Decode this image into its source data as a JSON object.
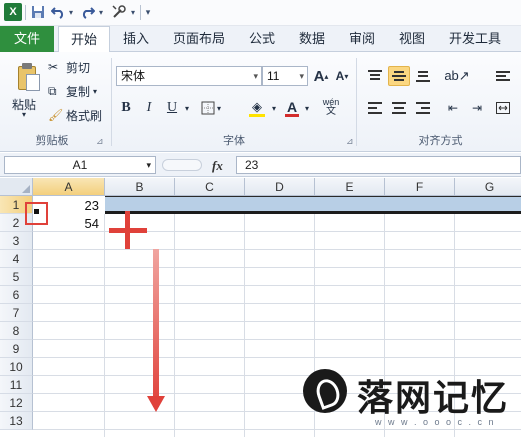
{
  "qat": {
    "app_icon": "X",
    "icons": [
      "save-icon",
      "undo-icon",
      "redo-icon",
      "customize-icon"
    ]
  },
  "tabs": [
    {
      "label": "文件"
    },
    {
      "label": "开始"
    },
    {
      "label": "插入"
    },
    {
      "label": "页面布局"
    },
    {
      "label": "公式"
    },
    {
      "label": "数据"
    },
    {
      "label": "审阅"
    },
    {
      "label": "视图"
    },
    {
      "label": "开发工具"
    }
  ],
  "ribbon": {
    "clipboard": {
      "paste_label": "粘贴",
      "cut_label": "剪切",
      "copy_label": "复制",
      "format_painter_label": "格式刷",
      "group_label": "剪贴板"
    },
    "font": {
      "font_name": "宋体",
      "font_size": "11",
      "grow_label": "A",
      "shrink_label": "A",
      "bold_label": "B",
      "italic_label": "I",
      "underline_label": "U",
      "font_color_label": "A",
      "phonetic_label": "wén",
      "group_label": "字体"
    },
    "alignment": {
      "group_label": "对齐方式"
    }
  },
  "formula_bar": {
    "name_box": "A1",
    "fx_label": "fx",
    "value": "23"
  },
  "sheet": {
    "columns": [
      "A",
      "B",
      "C",
      "D",
      "E",
      "F",
      "G"
    ],
    "rows": [
      "1",
      "2",
      "3",
      "4",
      "5",
      "6",
      "7",
      "8",
      "9",
      "10",
      "11",
      "12",
      "13"
    ],
    "cells": {
      "A1": "23",
      "A2": "54"
    },
    "selected_cell": "A1"
  },
  "annotations": {
    "plus_sign": "+",
    "colors": {
      "highlight": "#e0413a",
      "file_tab": "#2f8f3e",
      "row_select": "#b8cfe6"
    }
  },
  "watermark": {
    "text": "落网记忆",
    "url": "w w w . o o o c . c n"
  }
}
